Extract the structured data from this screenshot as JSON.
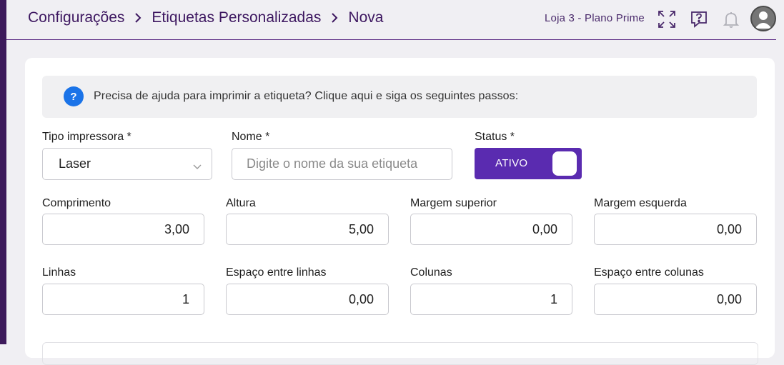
{
  "breadcrumb": {
    "items": [
      "Configurações",
      "Etiquetas Personalizadas",
      "Nova"
    ]
  },
  "header": {
    "store_label": "Loja 3 - Plano Prime",
    "icons": [
      "expand-icon",
      "help-chat-icon",
      "bell-icon",
      "user-avatar-icon"
    ]
  },
  "help": {
    "icon_text": "?",
    "text": "Precisa de ajuda para imprimir a etiqueta? Clique aqui e siga os seguintes passos:"
  },
  "form": {
    "printer_type": {
      "label": "Tipo impressora *",
      "value": "Laser"
    },
    "name": {
      "label": "Nome *",
      "placeholder": "Digite o nome da sua etiqueta",
      "value": ""
    },
    "status": {
      "label": "Status *",
      "value": "ATIVO"
    },
    "length": {
      "label": "Comprimento",
      "value": "3,00"
    },
    "height": {
      "label": "Altura",
      "value": "5,00"
    },
    "margin_top": {
      "label": "Margem superior",
      "value": "0,00"
    },
    "margin_left": {
      "label": "Margem esquerda",
      "value": "0,00"
    },
    "rows": {
      "label": "Linhas",
      "value": "1"
    },
    "row_spacing": {
      "label": "Espaço entre linhas",
      "value": "0,00"
    },
    "columns": {
      "label": "Colunas",
      "value": "1"
    },
    "column_spacing": {
      "label": "Espaço entre colunas",
      "value": "0,00"
    }
  },
  "colors": {
    "brand_purple": "#5a2bb0",
    "header_text": "#3d1760",
    "help_blue": "#1a73e8"
  }
}
